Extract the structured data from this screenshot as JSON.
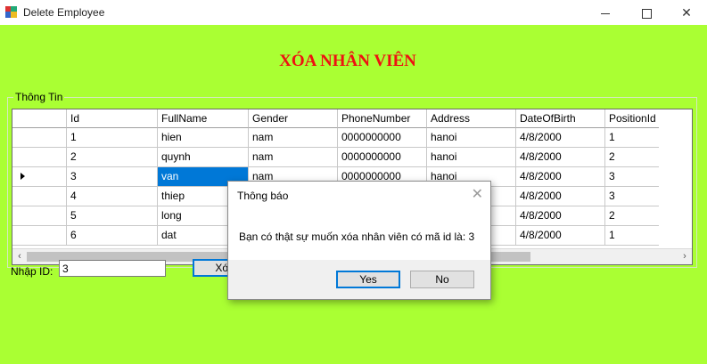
{
  "window": {
    "title": "Delete Employee",
    "min_icon": "minimize-icon",
    "max_icon": "maximize-icon",
    "close_icon": "close-icon"
  },
  "heading": "XÓA NHÂN VIÊN",
  "group": {
    "label": "Thông Tin"
  },
  "grid": {
    "columns": [
      "Id",
      "FullName",
      "Gender",
      "PhoneNumber",
      "Address",
      "DateOfBirth",
      "PositionId"
    ],
    "rows": [
      [
        "1",
        "hien",
        "nam",
        "0000000000",
        "hanoi",
        "4/8/2000",
        "1"
      ],
      [
        "2",
        "quynh",
        "nam",
        "0000000000",
        "hanoi",
        "4/8/2000",
        "2"
      ],
      [
        "3",
        "van",
        "nam",
        "0000000000",
        "hanoi",
        "4/8/2000",
        "3"
      ],
      [
        "4",
        "thiep",
        "",
        "",
        "",
        "4/8/2000",
        "3"
      ],
      [
        "5",
        "long",
        "",
        "",
        "",
        "4/8/2000",
        "2"
      ],
      [
        "6",
        "dat",
        "",
        "",
        "",
        "4/8/2000",
        "1"
      ]
    ],
    "current_row_index": 2,
    "selected_cell": "van"
  },
  "form": {
    "id_label": "Nhập ID:",
    "id_value": "3",
    "delete_label": "Xóa"
  },
  "dialog": {
    "title": "Thông báo",
    "message": "Bạn có thật sự muốn xóa nhân viên có mã id là: 3",
    "yes_label": "Yes",
    "no_label": "No"
  },
  "colors": {
    "background": "#aaff33",
    "heading": "#ee1111",
    "selection": "#0078d7"
  }
}
